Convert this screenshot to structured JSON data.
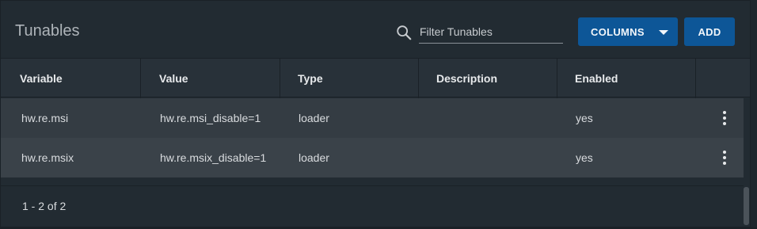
{
  "header": {
    "title": "Tunables",
    "search_placeholder": "Filter Tunables",
    "search_value": "",
    "columns_button_label": "COLUMNS",
    "add_button_label": "ADD"
  },
  "table": {
    "columns": [
      "Variable",
      "Value",
      "Type",
      "Description",
      "Enabled"
    ],
    "rows": [
      {
        "variable": "hw.re.msi",
        "value": "hw.re.msi_disable=1",
        "type": "loader",
        "description": "",
        "enabled": "yes"
      },
      {
        "variable": "hw.re.msix",
        "value": "hw.re.msix_disable=1",
        "type": "loader",
        "description": "",
        "enabled": "yes"
      }
    ]
  },
  "footer": {
    "pagination_text": "1 - 2 of 2"
  },
  "colors": {
    "primary_button": "#0d5697",
    "background": "#222b32",
    "header_row": "#283139",
    "row": "#343c43",
    "row_alt": "#3a4249"
  },
  "icons": {
    "search": "search-icon",
    "caret": "caret-down-icon",
    "row_menu": "more-vert-icon"
  }
}
